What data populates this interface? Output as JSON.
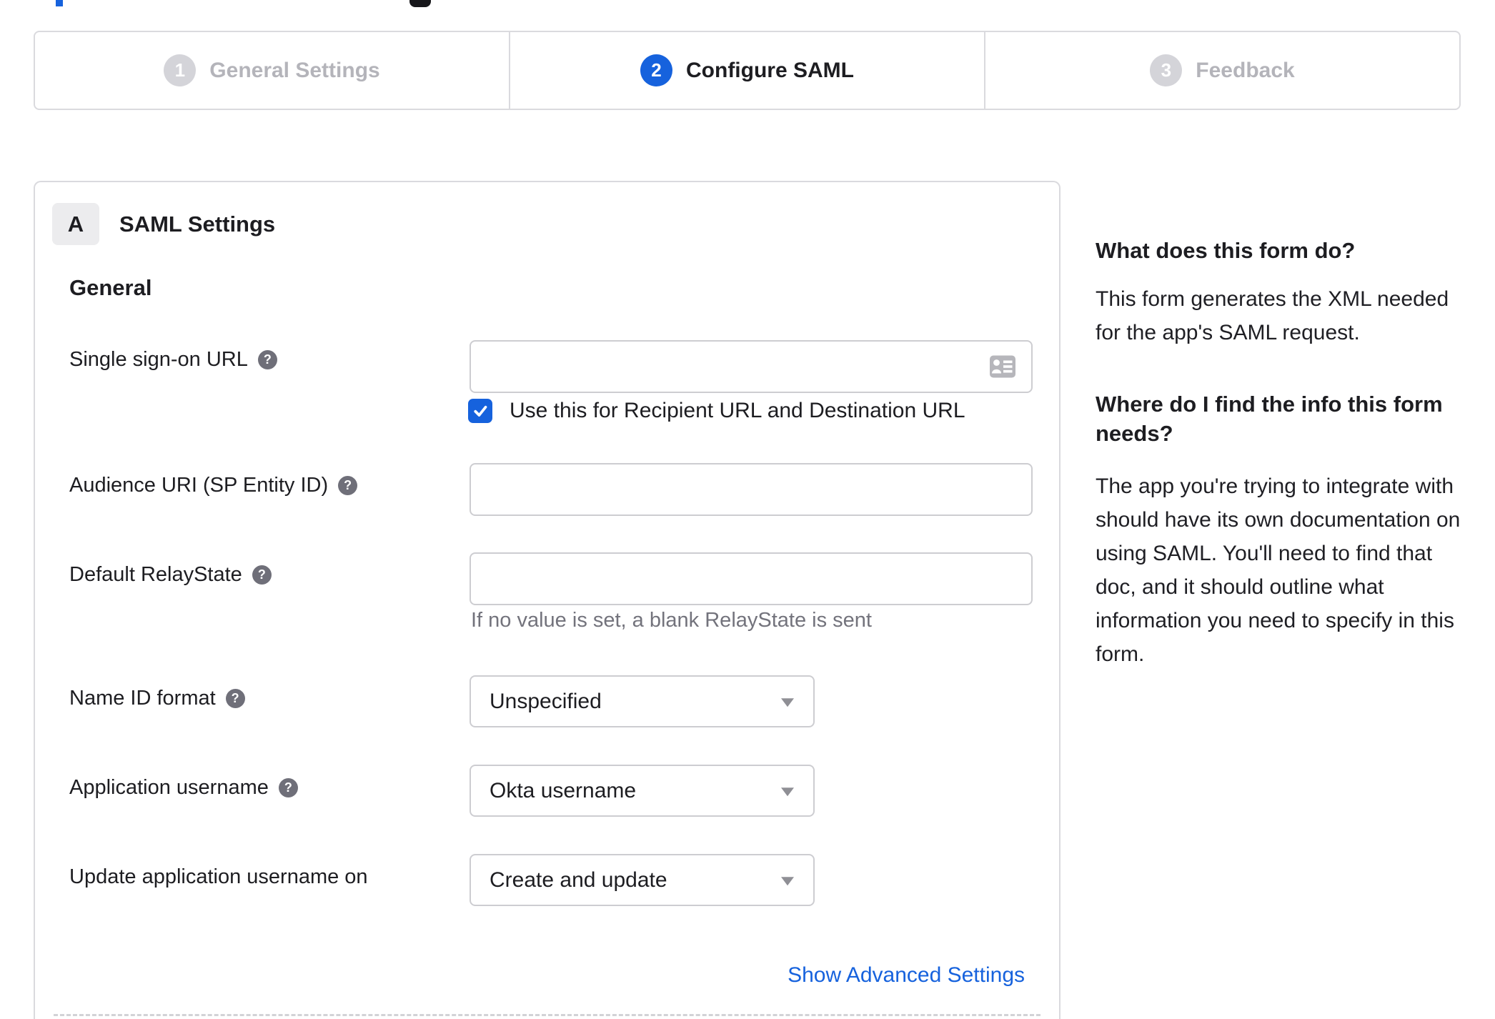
{
  "colors": {
    "accent_blue": "#1662dd",
    "text_dark": "#1d1d21",
    "hint_grey": "#73737c",
    "inactive_grey": "#b4b4ba",
    "border_grey": "#dadade"
  },
  "icons": {
    "help_glyph": "?"
  },
  "wizard": {
    "steps": [
      {
        "number": "1",
        "label": "General Settings",
        "state": "inactive"
      },
      {
        "number": "2",
        "label": "Configure SAML",
        "state": "active"
      },
      {
        "number": "3",
        "label": "Feedback",
        "state": "inactive"
      }
    ]
  },
  "panel": {
    "badge": "A",
    "title": "SAML Settings",
    "section": "General",
    "fields": {
      "sso": {
        "label": "Single sign-on URL",
        "value": "",
        "checkbox_label": "Use this for Recipient URL and Destination URL",
        "checkbox_checked": true
      },
      "audience": {
        "label": "Audience URI (SP Entity ID)",
        "value": ""
      },
      "relay": {
        "label": "Default RelayState",
        "value": "",
        "hint": "If no value is set, a blank RelayState is sent"
      },
      "nameid": {
        "label": "Name ID format",
        "value": "Unspecified"
      },
      "appuser": {
        "label": "Application username",
        "value": "Okta username"
      },
      "update": {
        "label": "Update application username on",
        "value": "Create and update"
      }
    },
    "advanced_link": "Show Advanced Settings"
  },
  "sidebar": {
    "sections": [
      {
        "heading": "What does this form do?",
        "body": "This form generates the XML needed for the app's SAML request."
      },
      {
        "heading": "Where do I find the info this form needs?",
        "body": "The app you're trying to integrate with should have its own documentation on using SAML. You'll need to find that doc, and it should outline what information you need to specify in this form."
      }
    ]
  }
}
